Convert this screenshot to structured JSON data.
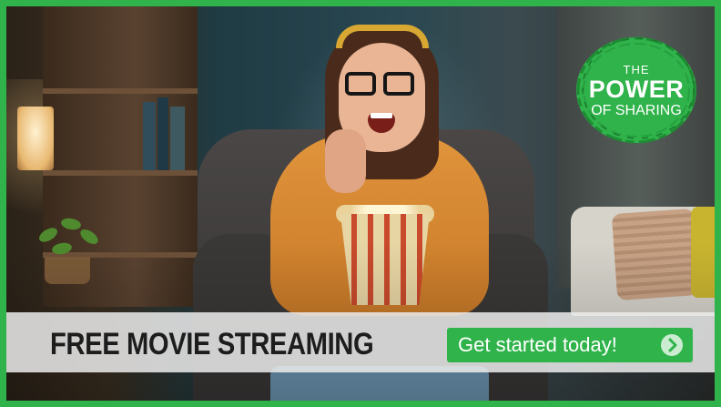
{
  "ad": {
    "headline": "FREE MOVIE STREAMING",
    "cta_label": "Get started today!",
    "cta_icon": "chevron-right-circle-icon"
  },
  "badge": {
    "line1": "THE",
    "line2": "POWER",
    "line3": "OF SHARING"
  },
  "colors": {
    "brand_green": "#2fb34a",
    "banner_bg": "#ebebeb",
    "headline_text": "#1d1d1d"
  }
}
